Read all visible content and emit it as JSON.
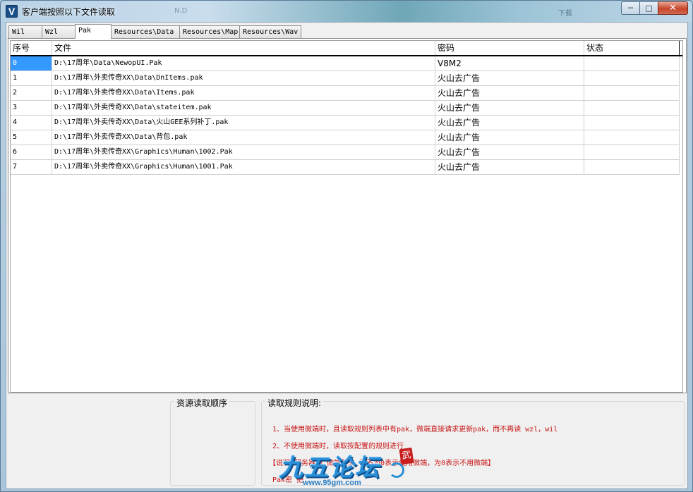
{
  "window": {
    "title": "客户端按照以下文件读取",
    "icon_letter": "V",
    "ghost_left": "N.D",
    "ghost_right": "下载",
    "buttons": {
      "minimize": "─",
      "maximize": "□",
      "close": "✕"
    }
  },
  "tabs": [
    {
      "label": "Wil",
      "active": false
    },
    {
      "label": "Wzl",
      "active": false
    },
    {
      "label": "Pak",
      "active": true
    },
    {
      "label": "Resources\\Data",
      "active": false
    },
    {
      "label": "Resources\\Map",
      "active": false
    },
    {
      "label": "Resources\\Wav",
      "active": false
    }
  ],
  "table": {
    "columns": [
      "序号",
      "文件",
      "密码",
      "状态"
    ],
    "rows": [
      {
        "idx": "0",
        "file": "D:\\17周年\\Data\\NewopUI.Pak",
        "password": "V8M2",
        "status": ""
      },
      {
        "idx": "1",
        "file": "D:\\17周年\\外卖传奇XX\\Data\\DnItems.pak",
        "password": "火山去广告",
        "status": ""
      },
      {
        "idx": "2",
        "file": "D:\\17周年\\外卖传奇XX\\Data\\Items.pak",
        "password": "火山去广告",
        "status": ""
      },
      {
        "idx": "3",
        "file": "D:\\17周年\\外卖传奇XX\\Data\\stateitem.pak",
        "password": "火山去广告",
        "status": ""
      },
      {
        "idx": "4",
        "file": "D:\\17周年\\外卖传奇XX\\Data\\火山GEE系列补丁.pak",
        "password": "火山去广告",
        "status": ""
      },
      {
        "idx": "5",
        "file": "D:\\17周年\\外卖传奇XX\\Data\\背包.pak",
        "password": "火山去广告",
        "status": ""
      },
      {
        "idx": "6",
        "file": "D:\\17周年\\外卖传奇XX\\Graphics\\Human\\1002.Pak",
        "password": "火山去广告",
        "status": ""
      },
      {
        "idx": "7",
        "file": "D:\\17周年\\外卖传奇XX\\Graphics\\Human\\1001.Pak",
        "password": "火山去广告",
        "status": ""
      }
    ],
    "selected_row": 0
  },
  "bottom": {
    "order_group_title": "资源读取顺序",
    "rules_group_title": "读取规则说明:",
    "rules": [
      "1、当使用微端时，且读取规则列表中有pak，微端直接请求更新pak，而不再读 wzl，wil",
      "2、不使用微端时，读取按配置的规则进行",
      "【说明    服务器列      微端开关         号不为0表示使用微端，为0表示不用微端】",
      "Pak密        把"
    ]
  },
  "watermark": {
    "text": "九五论坛",
    "url": "www.95gm.com",
    "stamp": "武"
  }
}
